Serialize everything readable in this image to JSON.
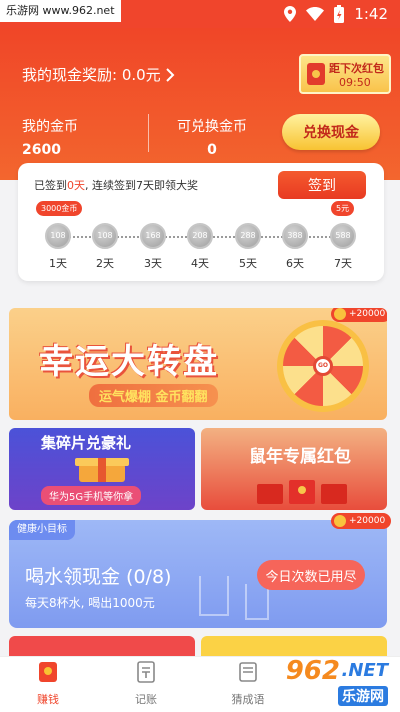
{
  "status_bar": {
    "watermark": "乐游网 www.962.net",
    "time": "1:42"
  },
  "header": {
    "reward_label": "我的现金奖励: 0.0元",
    "redpack_label": "距下次红包",
    "redpack_time": "09:50",
    "my_coins_label": "我的金币",
    "my_coins_value": "2600",
    "exchangeable_label": "可兑换金币",
    "exchangeable_value": "0",
    "redeem_button": "兑换现金"
  },
  "checkin": {
    "text_prefix": "已签到",
    "days_signed": "0天",
    "text_suffix": ", 连续签到7天即领大奖",
    "button": "签到",
    "days": [
      {
        "label": "1天",
        "coins": "108",
        "bubble": "3000金币"
      },
      {
        "label": "2天",
        "coins": "108",
        "bubble": ""
      },
      {
        "label": "3天",
        "coins": "168",
        "bubble": ""
      },
      {
        "label": "4天",
        "coins": "208",
        "bubble": ""
      },
      {
        "label": "5天",
        "coins": "288",
        "bubble": ""
      },
      {
        "label": "6天",
        "coins": "388",
        "bubble": ""
      },
      {
        "label": "7天",
        "coins": "588",
        "bubble": "5元"
      }
    ]
  },
  "wheel_banner": {
    "title": "幸运大转盘",
    "sub_a": "运气爆棚",
    "sub_b": "金币翻翻",
    "reward_tag": "+20000",
    "wheel_center": "GO"
  },
  "banner_left": {
    "title": "集碎片兑豪礼",
    "subtitle": "华为5G手机等你拿"
  },
  "banner_right": {
    "title": "鼠年专属红包"
  },
  "water_card": {
    "tag": "健康小目标",
    "title": "喝水领现金 (0/8)",
    "subtitle": "每天8杯水, 喝出1000元",
    "button": "今日次数已用尽",
    "reward_tag": "+20000"
  },
  "tabbar": {
    "tabs": [
      {
        "label": "赚钱",
        "active": true
      },
      {
        "label": "记账",
        "active": false
      },
      {
        "label": "猜成语",
        "active": false
      }
    ]
  },
  "watermark_bottom": {
    "num": "962",
    "net": ".NET",
    "cn": "乐游网"
  },
  "colors": {
    "primary": "#f0452c",
    "gold": "#f8c332",
    "water": "#8aa8f3"
  }
}
